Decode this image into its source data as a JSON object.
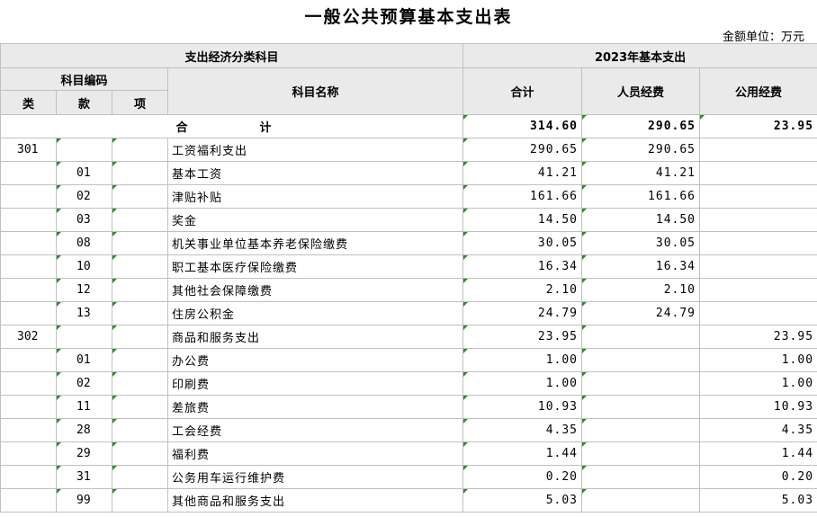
{
  "title": "一般公共预算基本支出表",
  "unit": "金额单位：万元",
  "header": {
    "group_left": "支出经济分类科目",
    "group_right": "2023年基本支出",
    "code_group": "科目编码",
    "lei": "类",
    "kuan": "款",
    "xiang": "项",
    "name": "科目名称",
    "total": "合计",
    "personnel": "人员经费",
    "public": "公用经费"
  },
  "total_row": {
    "label": "合　　计",
    "total": "314.60",
    "personnel": "290.65",
    "public": "23.95"
  },
  "rows": [
    {
      "lei": "301",
      "kuan": "",
      "xiang": "",
      "name": "工资福利支出",
      "total": "290.65",
      "personnel": "290.65",
      "public": ""
    },
    {
      "lei": "",
      "kuan": "01",
      "xiang": "",
      "name": "基本工资",
      "total": "41.21",
      "personnel": "41.21",
      "public": ""
    },
    {
      "lei": "",
      "kuan": "02",
      "xiang": "",
      "name": "津贴补贴",
      "total": "161.66",
      "personnel": "161.66",
      "public": ""
    },
    {
      "lei": "",
      "kuan": "03",
      "xiang": "",
      "name": "奖金",
      "total": "14.50",
      "personnel": "14.50",
      "public": ""
    },
    {
      "lei": "",
      "kuan": "08",
      "xiang": "",
      "name": "机关事业单位基本养老保险缴费",
      "total": "30.05",
      "personnel": "30.05",
      "public": ""
    },
    {
      "lei": "",
      "kuan": "10",
      "xiang": "",
      "name": "职工基本医疗保险缴费",
      "total": "16.34",
      "personnel": "16.34",
      "public": ""
    },
    {
      "lei": "",
      "kuan": "12",
      "xiang": "",
      "name": "其他社会保障缴费",
      "total": "2.10",
      "personnel": "2.10",
      "public": ""
    },
    {
      "lei": "",
      "kuan": "13",
      "xiang": "",
      "name": "住房公积金",
      "total": "24.79",
      "personnel": "24.79",
      "public": ""
    },
    {
      "lei": "302",
      "kuan": "",
      "xiang": "",
      "name": "商品和服务支出",
      "total": "23.95",
      "personnel": "",
      "public": "23.95"
    },
    {
      "lei": "",
      "kuan": "01",
      "xiang": "",
      "name": "办公费",
      "total": "1.00",
      "personnel": "",
      "public": "1.00"
    },
    {
      "lei": "",
      "kuan": "02",
      "xiang": "",
      "name": "印刷费",
      "total": "1.00",
      "personnel": "",
      "public": "1.00"
    },
    {
      "lei": "",
      "kuan": "11",
      "xiang": "",
      "name": "差旅费",
      "total": "10.93",
      "personnel": "",
      "public": "10.93"
    },
    {
      "lei": "",
      "kuan": "28",
      "xiang": "",
      "name": "工会经费",
      "total": "4.35",
      "personnel": "",
      "public": "4.35"
    },
    {
      "lei": "",
      "kuan": "29",
      "xiang": "",
      "name": "福利费",
      "total": "1.44",
      "personnel": "",
      "public": "1.44"
    },
    {
      "lei": "",
      "kuan": "31",
      "xiang": "",
      "name": "公务用车运行维护费",
      "total": "0.20",
      "personnel": "",
      "public": "0.20"
    },
    {
      "lei": "",
      "kuan": "99",
      "xiang": "",
      "name": "其他商品和服务支出",
      "total": "5.03",
      "personnel": "",
      "public": "5.03"
    }
  ]
}
